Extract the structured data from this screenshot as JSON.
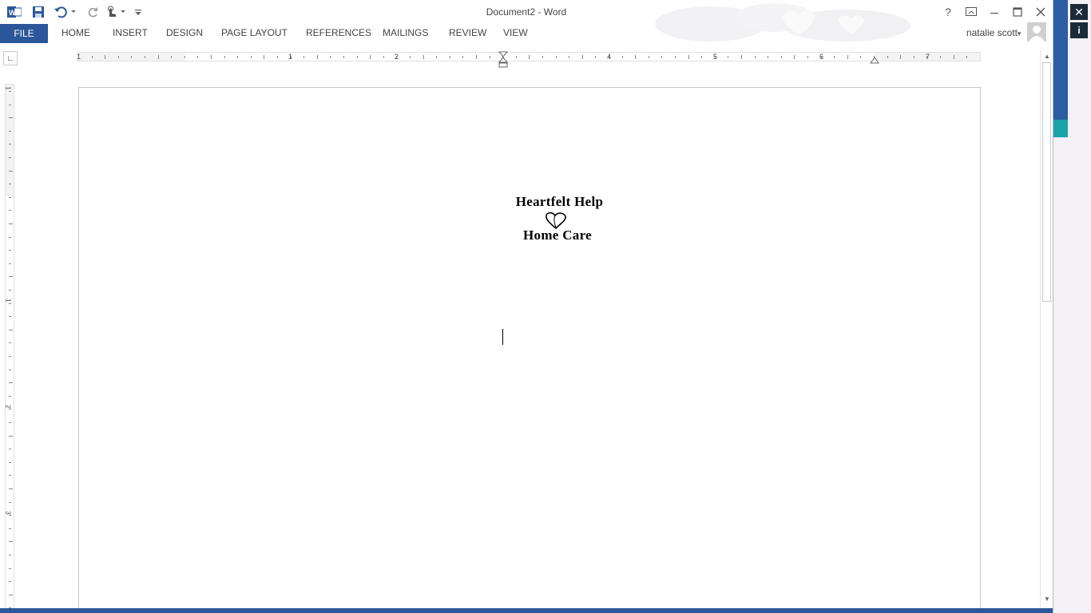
{
  "app": {
    "window_title": "Document2 - Word",
    "help_label": "?",
    "file_tab": "FILE",
    "tabs": [
      "HOME",
      "INSERT",
      "DESIGN",
      "PAGE LAYOUT",
      "REFERENCES",
      "MAILINGS",
      "REVIEW",
      "VIEW"
    ],
    "user_name": "natalie scott"
  },
  "ruler": {
    "horizontal_labels": [
      "1",
      "1",
      "2",
      "4",
      "5",
      "6",
      "7"
    ],
    "vertical_labels": [
      "1",
      "1",
      "2",
      "3"
    ]
  },
  "document": {
    "line1": "Heartfelt Help",
    "line3": "Home Care"
  },
  "side_panel": {
    "close_glyph": "✕",
    "info_glyph": "i"
  },
  "colors": {
    "accent": "#2b579a",
    "status_bar": "#2b579a"
  },
  "icons": [
    "word-logo-icon",
    "save-icon",
    "undo-icon",
    "redo-icon",
    "touch-mode-icon",
    "customize-qat-icon",
    "help-icon",
    "ribbon-display-icon",
    "minimize-icon",
    "maximize-icon",
    "close-icon",
    "heart-icon"
  ]
}
